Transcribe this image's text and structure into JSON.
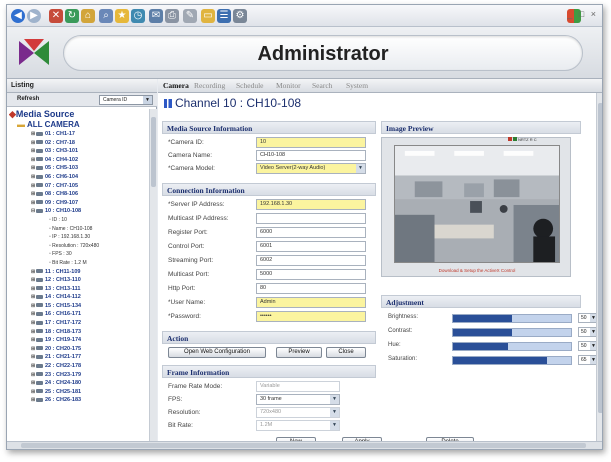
{
  "app": {
    "title": "Administrator"
  },
  "browser": {
    "window_controls": "_ □ ×"
  },
  "left": {
    "tab_label": "Listing",
    "refresh_label": "Refresh",
    "select_value": "Camera ID",
    "tree_root": "Media Source",
    "tree_all": "ALL CAMERA",
    "cameras_before": [
      "01 : CH1-17",
      "02 : CH7-18",
      "03 : CH3-101",
      "04 : CH4-102",
      "05 : CH5-103",
      "06 : CH6-104",
      "07 : CH7-105",
      "08 : CH8-106",
      "09 : CH9-107"
    ],
    "selected_camera": "10 : CH10-108",
    "selected_details": [
      "ID : 10",
      "Name : CH10-108",
      "IP : 192.168.1.30",
      "Resolution : 720x480",
      "FPS : 30",
      "Bit Rate : 1.2 M"
    ],
    "cameras_after": [
      "11 : CH11-109",
      "12 : CH13-110",
      "13 : CH13-111",
      "14 : CH14-112",
      "15 : CH15-134",
      "16 : CH16-171",
      "17 : CH17-172",
      "18 : CH18-173",
      "19 : CH19-174",
      "20 : CH20-175",
      "21 : CH21-177",
      "22 : CH22-178",
      "23 : CH23-179",
      "24 : CH24-180",
      "25 : CH25-181",
      "26 : CH26-183"
    ]
  },
  "tabs": [
    "Camera",
    "Recording",
    "Schedule",
    "Monitor",
    "Search",
    "System"
  ],
  "channel": {
    "title": "Channel 10 : CH10-108"
  },
  "camera_info": {
    "header": "Media Source Information",
    "fields": [
      {
        "label": "*Camera ID:",
        "value": "10"
      },
      {
        "label": "Camera Name:",
        "value": "CH10-108"
      },
      {
        "label": "*Camera Model:",
        "value": "Video Server(2-way Audio)"
      }
    ]
  },
  "connection": {
    "header": "Connection Information",
    "fields": [
      {
        "label": "*Server IP Address:",
        "value": "192.168.1.30"
      },
      {
        "label": "Multicast IP Address:",
        "value": ""
      },
      {
        "label": "Register Port:",
        "value": "6000"
      },
      {
        "label": "Control Port:",
        "value": "6001"
      },
      {
        "label": "Streaming Port:",
        "value": "6002"
      },
      {
        "label": "Multicast Port:",
        "value": "5000"
      },
      {
        "label": "Http Port:",
        "value": "80"
      },
      {
        "label": "*User Name:",
        "value": "Admin"
      },
      {
        "label": "*Password:",
        "value": "••••••"
      }
    ]
  },
  "action": {
    "header": "Action",
    "open_web": "Open Web Configuration",
    "preview": "Preview",
    "close": "Close"
  },
  "frame": {
    "header": "Frame Information",
    "fields": [
      {
        "label": "Frame Rate Mode:",
        "value": "Variable"
      },
      {
        "label": "FPS:",
        "value": "30 frame"
      },
      {
        "label": "Resolution:",
        "value": "720x480"
      },
      {
        "label": "Bit Rate:",
        "value": "1.2M"
      }
    ]
  },
  "bottom_buttons": {
    "new": "New",
    "apply": "Apply",
    "delete": "Delete"
  },
  "preview": {
    "header": "Image Preview",
    "status": "NRTZ R C",
    "download": "Download & Setup the ActiveX Control"
  },
  "adjustment": {
    "header": "Adjustment",
    "items": [
      {
        "label": "Brightness:",
        "value": "50",
        "level": 0.5
      },
      {
        "label": "Contrast:",
        "value": "50",
        "level": 0.5
      },
      {
        "label": "Hue:",
        "value": "50",
        "level": 0.47
      },
      {
        "label": "Saturation:",
        "value": "65",
        "level": 0.8
      }
    ]
  }
}
